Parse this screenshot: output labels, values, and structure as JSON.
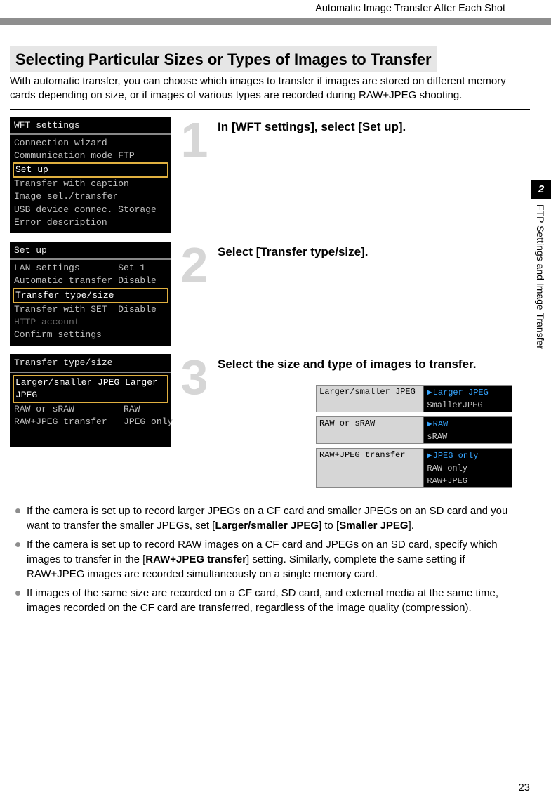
{
  "header": {
    "chapter_title": "Automatic Image Transfer After Each Shot"
  },
  "section": {
    "title": "Selecting Particular Sizes or Types of Images to Transfer",
    "intro": "With automatic transfer, you can choose which images to transfer if images are stored on different memory cards depending on size, or if images of various types are recorded during RAW+JPEG shooting."
  },
  "sidebar": {
    "number": "2",
    "label": "FTP Settings and Image Transfer"
  },
  "steps": {
    "s1": {
      "num": "1",
      "text": "In [WFT settings], select [Set up].",
      "lcd_title": "WFT settings",
      "rows": {
        "r0": "Connection wizard",
        "r1": "Communication mode FTP",
        "r2": "Set up",
        "r3": "Transfer with caption",
        "r4": "Image sel./transfer",
        "r5": "USB device connec. Storage",
        "r6": "Error description"
      }
    },
    "s2": {
      "num": "2",
      "text": "Select [Transfer type/size].",
      "lcd_title": "Set up",
      "rows": {
        "r0": "LAN settings       Set 1",
        "r1": "Automatic transfer Disable",
        "r2": "Transfer type/size",
        "r3": "Transfer with SET  Disable",
        "r4": "HTTP account",
        "r5": "Confirm settings"
      }
    },
    "s3": {
      "num": "3",
      "text": "Select the size and type of images to transfer.",
      "lcd_title": "Transfer type/size",
      "rows": {
        "r0": "Larger/smaller JPEG Larger JPEG",
        "r1": "RAW or sRAW         RAW",
        "r2": "RAW+JPEG transfer   JPEG only"
      }
    }
  },
  "popouts": {
    "p1": {
      "label": "Larger/smaller JPEG",
      "sel": "Larger JPEG",
      "o1": "SmallerJPEG"
    },
    "p2": {
      "label": "RAW or sRAW",
      "sel": "RAW",
      "o1": "sRAW"
    },
    "p3": {
      "label": "RAW+JPEG transfer",
      "sel": "JPEG only",
      "o1": "RAW only",
      "o2": "RAW+JPEG"
    }
  },
  "bullets": {
    "b1a": "If the camera is set up to record larger JPEGs on a CF card and smaller JPEGs on an SD card and you want to transfer the smaller JPEGs, set [",
    "b1b": "Larger/smaller JPEG",
    "b1c": "] to [",
    "b1d": "Smaller JPEG",
    "b1e": "].",
    "b2a": "If the camera is set up to record RAW images on a CF card and JPEGs on an SD card, specify which images to transfer in the [",
    "b2b": "RAW+JPEG transfer",
    "b2c": "] setting. Similarly, complete the same setting if RAW+JPEG images are recorded simultaneously on a single memory card.",
    "b3": "If images of the same size are recorded on a CF card, SD card, and external media at the same time, images recorded on the CF card are transferred, regardless of the image quality (compression)."
  },
  "page_number": "23"
}
